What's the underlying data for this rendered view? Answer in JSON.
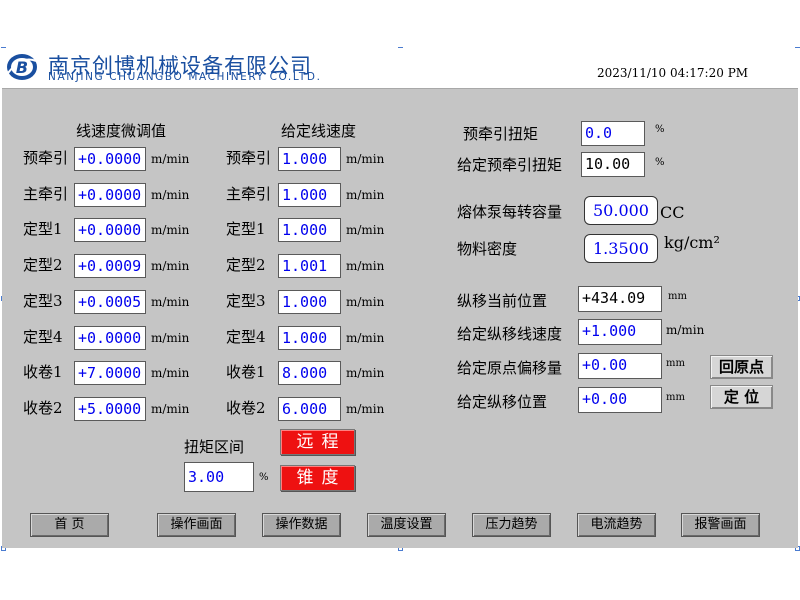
{
  "header": {
    "company_cn": "南京创博机械设备有限公司",
    "company_en": "NANJING CHUANGBO MACHINERY CO.LTD.",
    "logo_letter": "B",
    "datetime": "2023/11/10 04:17:20 PM"
  },
  "speed_table": {
    "col1_title": "线速度微调值",
    "col2_title": "给定线速度",
    "unit": "m/min",
    "rows": [
      {
        "label": "预牵引",
        "trim": "+0.0000",
        "setpoint": "1.000"
      },
      {
        "label": "主牵引",
        "trim": "+0.0000",
        "setpoint": "1.000"
      },
      {
        "label": "定型1",
        "trim": "+0.0000",
        "setpoint": "1.000"
      },
      {
        "label": "定型2",
        "trim": "+0.0009",
        "setpoint": "1.001"
      },
      {
        "label": "定型3",
        "trim": "+0.0005",
        "setpoint": "1.000"
      },
      {
        "label": "定型4",
        "trim": "+0.0000",
        "setpoint": "1.000"
      },
      {
        "label": "收卷1",
        "trim": "+7.0000",
        "setpoint": "8.000"
      },
      {
        "label": "收卷2",
        "trim": "+5.0000",
        "setpoint": "6.000"
      }
    ]
  },
  "torque_zone": {
    "label": "扭矩区间",
    "value": "3.00",
    "unit": "%",
    "remote_button": "远程",
    "taper_button": "锥度"
  },
  "right_panel": {
    "pre_torque_label": "预牵引扭矩",
    "pre_torque_value": "0.0",
    "pre_torque_unit": "%",
    "set_pre_torque_label": "给定预牵引扭矩",
    "set_pre_torque_value": "10.00",
    "set_pre_torque_unit": "%",
    "pump_label": "熔体泵每转容量",
    "pump_value": "50.000",
    "pump_unit": "CC",
    "density_label": "物料密度",
    "density_value": "1.3500",
    "density_unit": "kg/cm²",
    "long_pos_label": "纵移当前位置",
    "long_pos_value": "+434.09",
    "long_pos_unit": "mm",
    "long_speed_label": "给定纵移线速度",
    "long_speed_value": "+1.000",
    "long_speed_unit": "m/min",
    "origin_offset_label": "给定原点偏移量",
    "origin_offset_value": "+0.00",
    "origin_offset_unit": "mm",
    "set_long_pos_label": "给定纵移位置",
    "set_long_pos_value": "+0.00",
    "set_long_pos_unit": "mm",
    "home_button": "回原点",
    "position_button": "定 位"
  },
  "nav": [
    "首 页",
    "操作画面",
    "操作数据",
    "温度设置",
    "压力趋势",
    "电流趋势",
    "报警画面"
  ],
  "colors": {
    "panel": "#c5c5c5",
    "value_text": "#0000ee",
    "red_button": "#ee1111",
    "brand_blue": "#1a4fa0"
  }
}
